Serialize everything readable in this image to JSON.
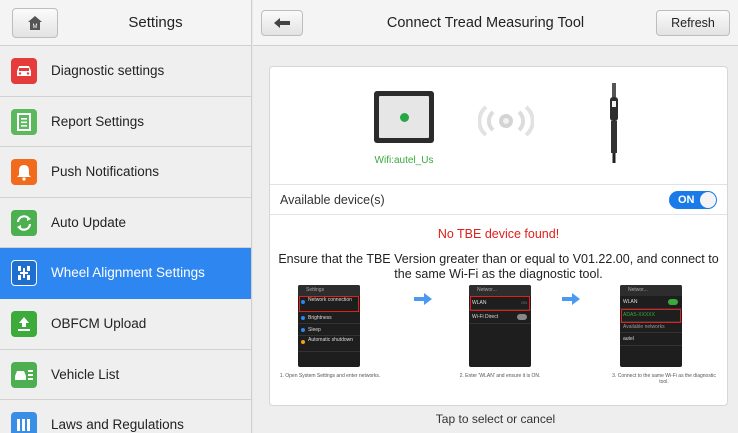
{
  "settings_panel": {
    "title": "Settings",
    "items": [
      {
        "label": "Diagnostic settings",
        "icon": "car-icon",
        "color": "#e63b3b"
      },
      {
        "label": "Report Settings",
        "icon": "report-icon",
        "color": "#5cb85c"
      },
      {
        "label": "Push Notifications",
        "icon": "bell-icon",
        "color": "#f26b1d"
      },
      {
        "label": "Auto Update",
        "icon": "refresh-icon",
        "color": "#4caf50"
      },
      {
        "label": "Wheel Alignment Settings",
        "icon": "wheel-alignment-icon",
        "color": "#1f6fd1",
        "active": true
      },
      {
        "label": "OBFCM Upload",
        "icon": "upload-icon",
        "color": "#3cab3c"
      },
      {
        "label": "Vehicle List",
        "icon": "vehicle-list-icon",
        "color": "#4caf50"
      },
      {
        "label": "Laws and Regulations",
        "icon": "laws-icon",
        "color": "#3a8ee6"
      }
    ]
  },
  "main": {
    "title": "Connect Tread Measuring Tool",
    "refresh_label": "Refresh",
    "wifi_label": "Wifi:autel_Us",
    "available_label": "Available device(s)",
    "toggle_label": "ON",
    "no_device": "No TBE device found!",
    "ensure_text": "Ensure that the TBE Version greater than or equal to V01.22.00, and connect to the same Wi-Fi as the diagnostic tool.",
    "steps": [
      {
        "caption": "1. Open System Settings and enter networks."
      },
      {
        "caption": "2. Enter 'WLAN' and ensure it is ON."
      },
      {
        "caption": "3. Connect to the same Wi-Fi as the diagnostic tool."
      }
    ],
    "phone1": {
      "header": "Settings",
      "rows": [
        "Network connection",
        "Brightness",
        "Sleep",
        "Automatic shutdown"
      ]
    },
    "phone2": {
      "header": "Networ...",
      "rows": [
        "WLAN",
        "Wi-Fi Direct"
      ],
      "wlan_state": "ON"
    },
    "phone3": {
      "header": "Networ...",
      "rows": [
        "WLAN",
        "ADAS-XXXXX",
        "Available networks",
        "autel"
      ]
    },
    "footer": "Tap to select or cancel"
  },
  "colors": {
    "accent": "#2e86f0",
    "error": "#e0201b",
    "toggle": "#1a7ae8"
  }
}
